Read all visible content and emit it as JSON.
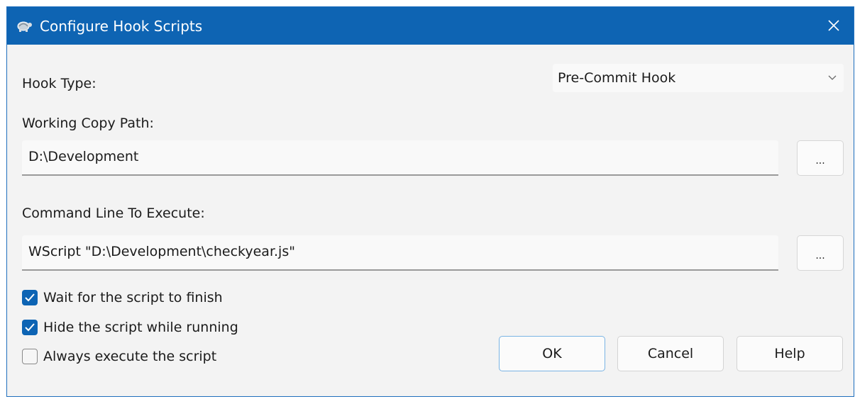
{
  "window": {
    "title": "Configure Hook Scripts",
    "accent": "#0e64b3"
  },
  "hook_type": {
    "label": "Hook Type:",
    "value": "Pre-Commit Hook"
  },
  "working_copy": {
    "label": "Working Copy Path:",
    "value": "D:\\Development",
    "browse_label": "..."
  },
  "command_line": {
    "label": "Command Line To Execute:",
    "value": "WScript \"D:\\Development\\checkyear.js\"",
    "browse_label": "..."
  },
  "options": [
    {
      "label": "Wait for the script to finish",
      "checked": true
    },
    {
      "label": "Hide the script while running",
      "checked": true
    },
    {
      "label": "Always execute the script",
      "checked": false
    }
  ],
  "buttons": {
    "ok": "OK",
    "cancel": "Cancel",
    "help": "Help"
  },
  "icons": {
    "app": "tortoise-icon",
    "close": "close-icon",
    "dropdown": "chevron-down-icon",
    "check": "checkmark-icon"
  }
}
